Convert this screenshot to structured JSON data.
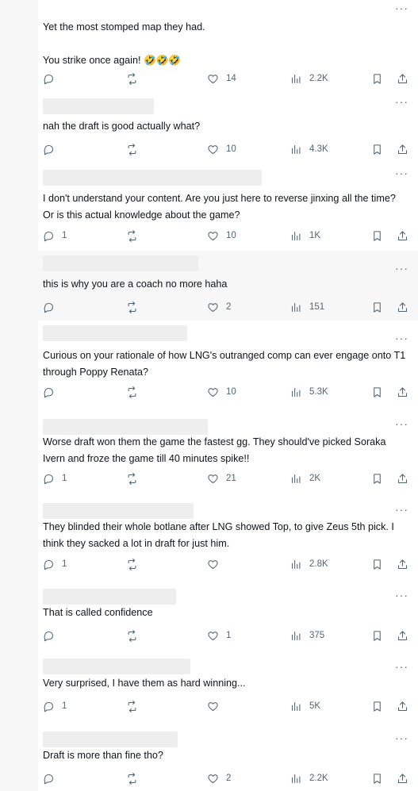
{
  "replies": [
    {
      "text": "Yet the most stomped map they had.\n\nYou strike once again! 🤣🤣🤣",
      "reply_count": "",
      "like_count": "14",
      "view_count": "2.2K"
    },
    {
      "text": "nah the draft is good actually what?",
      "reply_count": "",
      "like_count": "10",
      "view_count": "4.3K"
    },
    {
      "text": "I don't understand your content. Are you just here to reverse jinxing all the time? Or is this actual knowledge about the game?",
      "reply_count": "1",
      "like_count": "10",
      "view_count": "1K"
    },
    {
      "text": "this is why you are a coach no more haha",
      "reply_count": "",
      "like_count": "2",
      "view_count": "151"
    },
    {
      "text": "Curious on your rationale of how LNG's outranged comp can ever engage onto T1 through Poppy Renata?",
      "reply_count": "",
      "like_count": "10",
      "view_count": "5.3K"
    },
    {
      "text": "Worse draft won them the game the fastest gg. They should've picked Soraka Ivern and froze the game till 40 minutes spike!!",
      "reply_count": "1",
      "like_count": "21",
      "view_count": "2K"
    },
    {
      "text": "They blinded their whole botlane after LNG showed Top, to give Zeus 5th pick. I think they sacked a lot in draft for just him.",
      "reply_count": "1",
      "like_count": "",
      "view_count": "2.8K"
    },
    {
      "text": "That is called confidence",
      "reply_count": "",
      "like_count": "1",
      "view_count": "375"
    },
    {
      "text": "Very surprised, I have them as hard winning...",
      "reply_count": "1",
      "like_count": "",
      "view_count": "5K"
    },
    {
      "text": "Draft is more than fine tho?",
      "reply_count": "",
      "like_count": "2",
      "view_count": "2.2K"
    }
  ],
  "more_label": "···",
  "icons": [
    "reply-icon",
    "repost-icon",
    "like-icon",
    "views-icon",
    "bookmark-icon",
    "share-icon"
  ],
  "colors": {
    "icon": "#536471",
    "text": "#0f1419",
    "divider": "#eff3f4",
    "alt_background": "#f7f7f7"
  }
}
